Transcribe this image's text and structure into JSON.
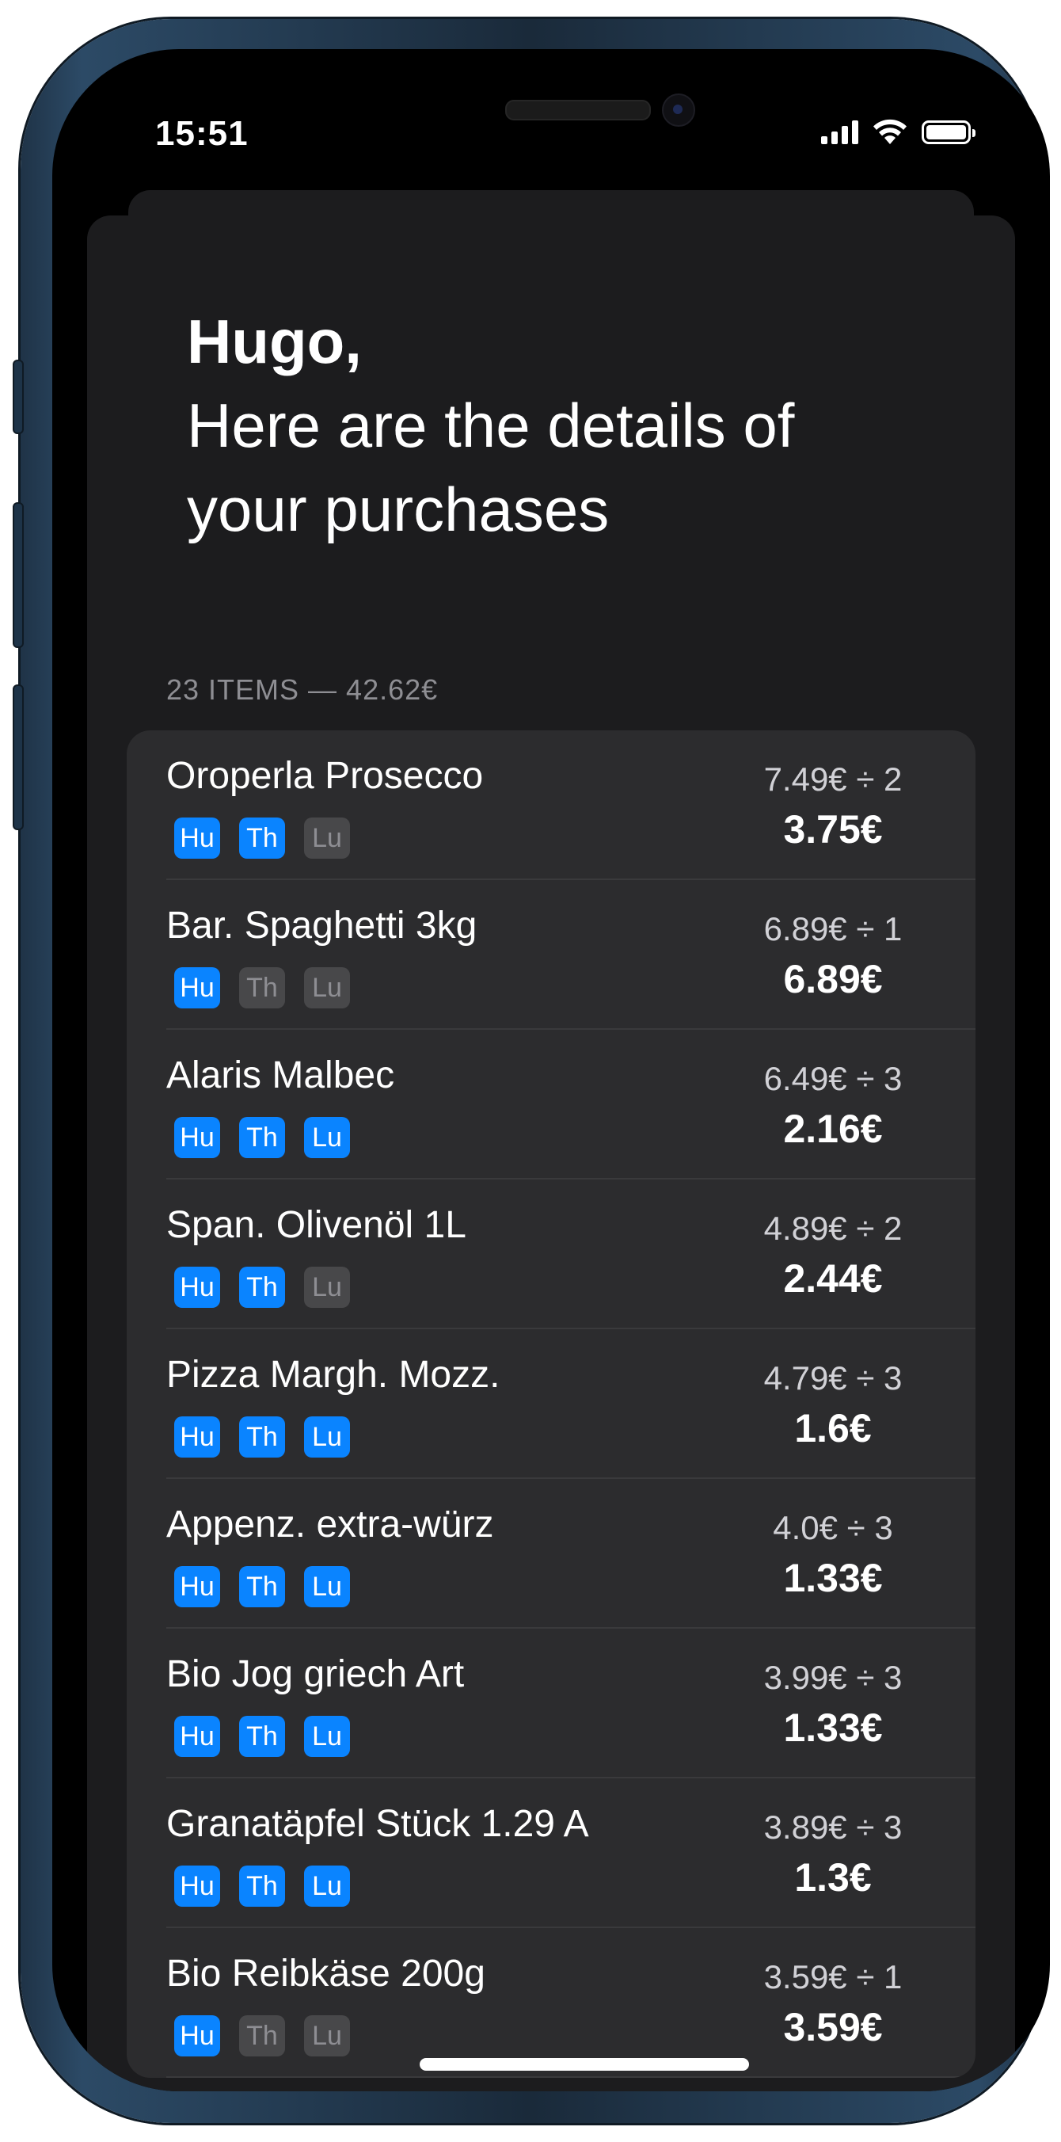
{
  "status_bar": {
    "time": "15:51"
  },
  "header": {
    "name": "Hugo,",
    "message": "Here are the details of your purchases"
  },
  "summary": "23 ITEMS — 42.62€",
  "items": [
    {
      "name": "Oroperla Prosecco",
      "price": "7.49€ ÷ 2",
      "share": "3.75€",
      "tags": [
        {
          "label": "Hu",
          "active": true
        },
        {
          "label": "Th",
          "active": true
        },
        {
          "label": "Lu",
          "active": false
        }
      ]
    },
    {
      "name": "Bar. Spaghetti 3kg",
      "price": "6.89€ ÷ 1",
      "share": "6.89€",
      "tags": [
        {
          "label": "Hu",
          "active": true
        },
        {
          "label": "Th",
          "active": false
        },
        {
          "label": "Lu",
          "active": false
        }
      ]
    },
    {
      "name": "Alaris Malbec",
      "price": "6.49€ ÷ 3",
      "share": "2.16€",
      "tags": [
        {
          "label": "Hu",
          "active": true
        },
        {
          "label": "Th",
          "active": true
        },
        {
          "label": "Lu",
          "active": true
        }
      ]
    },
    {
      "name": "Span. Olivenöl 1L",
      "price": "4.89€ ÷ 2",
      "share": "2.44€",
      "tags": [
        {
          "label": "Hu",
          "active": true
        },
        {
          "label": "Th",
          "active": true
        },
        {
          "label": "Lu",
          "active": false
        }
      ]
    },
    {
      "name": "Pizza Margh. Mozz.",
      "price": "4.79€ ÷ 3",
      "share": "1.6€",
      "tags": [
        {
          "label": "Hu",
          "active": true
        },
        {
          "label": "Th",
          "active": true
        },
        {
          "label": "Lu",
          "active": true
        }
      ]
    },
    {
      "name": "Appenz. extra-würz",
      "price": "4.0€ ÷ 3",
      "share": "1.33€",
      "tags": [
        {
          "label": "Hu",
          "active": true
        },
        {
          "label": "Th",
          "active": true
        },
        {
          "label": "Lu",
          "active": true
        }
      ]
    },
    {
      "name": "Bio Jog griech Art",
      "price": "3.99€ ÷ 3",
      "share": "1.33€",
      "tags": [
        {
          "label": "Hu",
          "active": true
        },
        {
          "label": "Th",
          "active": true
        },
        {
          "label": "Lu",
          "active": true
        }
      ]
    },
    {
      "name": "Granatäpfel Stück 1.29 A",
      "price": "3.89€ ÷ 3",
      "share": "1.3€",
      "tags": [
        {
          "label": "Hu",
          "active": true
        },
        {
          "label": "Th",
          "active": true
        },
        {
          "label": "Lu",
          "active": true
        }
      ]
    },
    {
      "name": "Bio Reibkäse 200g",
      "price": "3.59€ ÷ 1",
      "share": "3.59€",
      "tags": [
        {
          "label": "Hu",
          "active": true
        },
        {
          "label": "Th",
          "active": false
        },
        {
          "label": "Lu",
          "active": false
        }
      ]
    }
  ],
  "colors": {
    "accent": "#0a84ff",
    "sheet": "#1c1c1e",
    "cell": "#2c2c2e",
    "tag_off": "#48484a",
    "frame": "#1f3347"
  },
  "icons": [
    "cellular-signal-icon",
    "wifi-icon",
    "battery-icon"
  ]
}
